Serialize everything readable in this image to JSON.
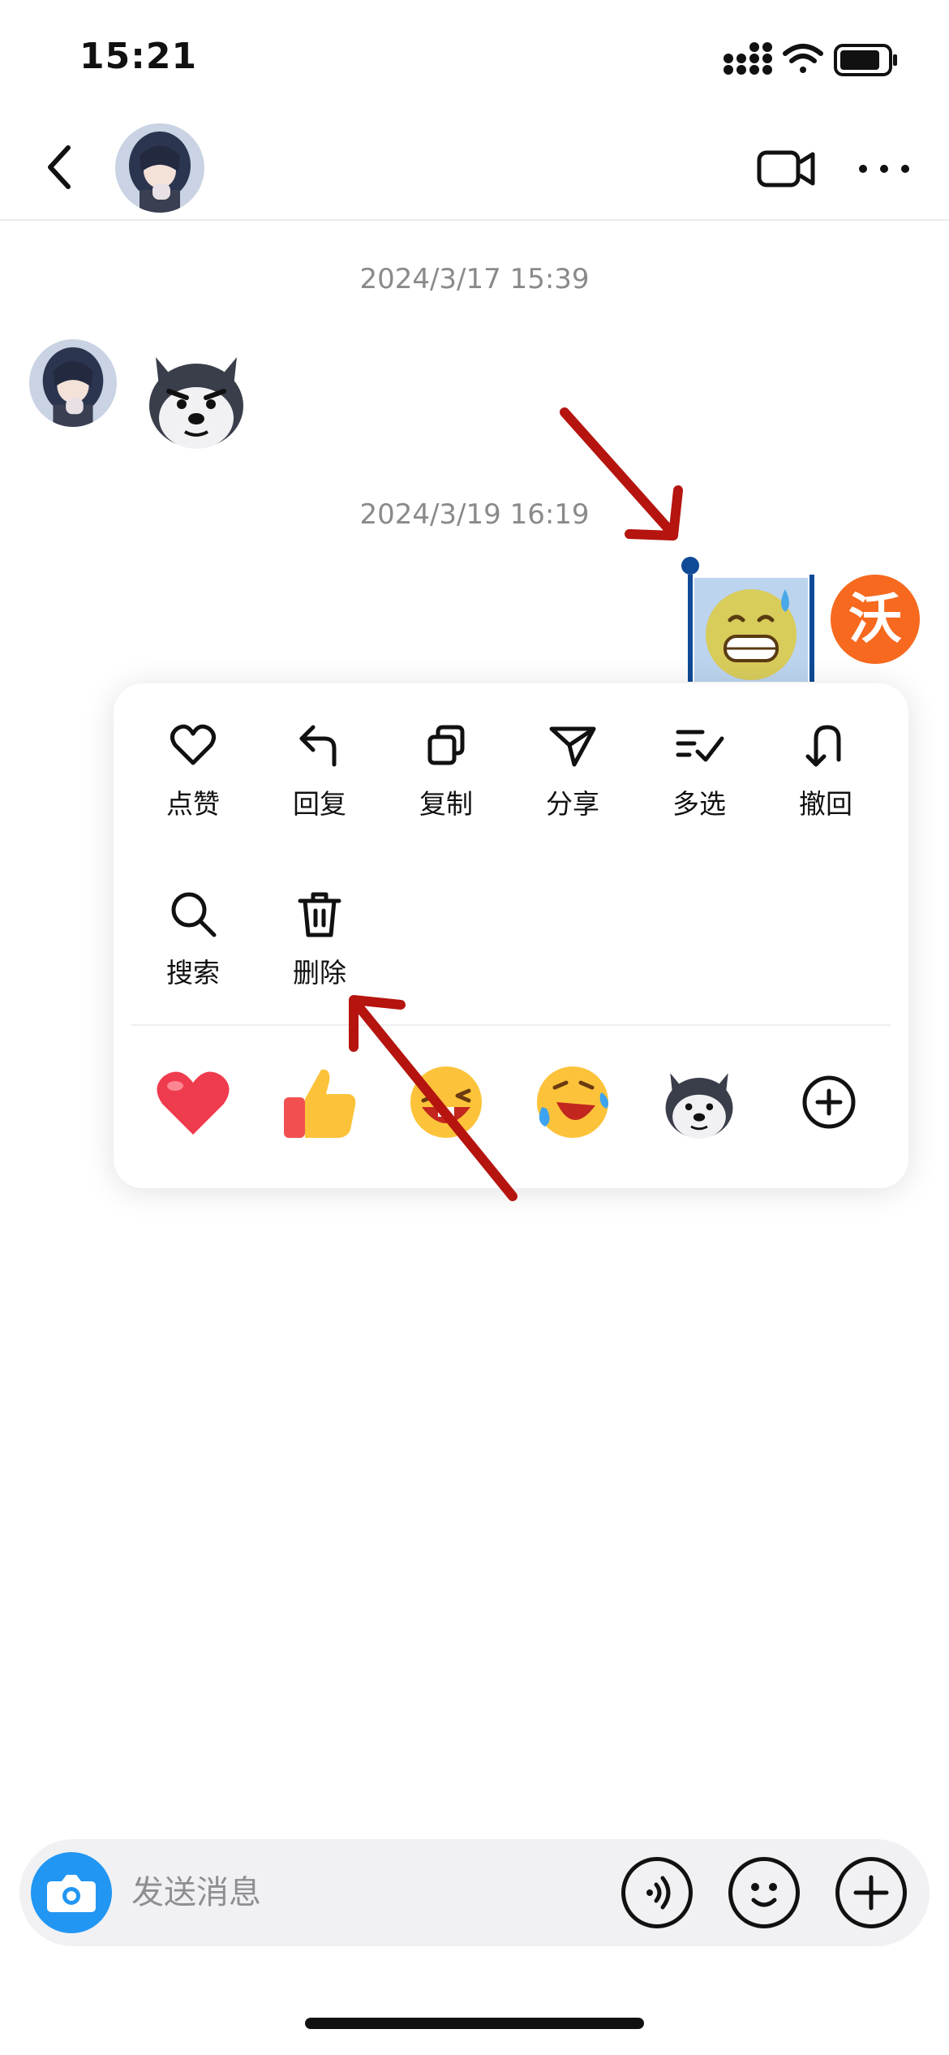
{
  "status_bar": {
    "time": "15:21",
    "icons": [
      "signal-icon",
      "wifi-icon",
      "battery-icon"
    ]
  },
  "nav": {
    "back_icon": "chevron-left-icon",
    "video_icon": "video-camera-icon",
    "more_icon": "more-dots-icon"
  },
  "messages": {
    "timestamp_1": "2024/3/17 15:39",
    "timestamp_2": "2024/3/19 16:19",
    "own_avatar_text": "沃"
  },
  "context_menu": {
    "actions": [
      {
        "label": "点赞",
        "icon": "heart-outline-icon"
      },
      {
        "label": "回复",
        "icon": "reply-icon"
      },
      {
        "label": "复制",
        "icon": "copy-icon"
      },
      {
        "label": "分享",
        "icon": "share-send-icon"
      },
      {
        "label": "多选",
        "icon": "multi-select-icon"
      },
      {
        "label": "撤回",
        "icon": "recall-icon"
      },
      {
        "label": "搜索",
        "icon": "search-icon"
      },
      {
        "label": "删除",
        "icon": "trash-icon"
      }
    ],
    "reactions": [
      "heart-emoji-icon",
      "thumbs-up-emoji-icon",
      "wink-laugh-emoji-icon",
      "rofl-emoji-icon",
      "husky-sticker-icon",
      "add-reaction-icon"
    ]
  },
  "input_bar": {
    "placeholder": "发送消息",
    "camera_icon": "camera-icon",
    "voice_icon": "voice-icon",
    "emoji_icon": "emoji-icon",
    "plus_icon": "plus-icon"
  },
  "colors": {
    "accent_blue": "#2196f3",
    "selection_blue": "#0f4a96",
    "annotation_red": "#b5140f",
    "avatar_orange": "#f6691e"
  }
}
